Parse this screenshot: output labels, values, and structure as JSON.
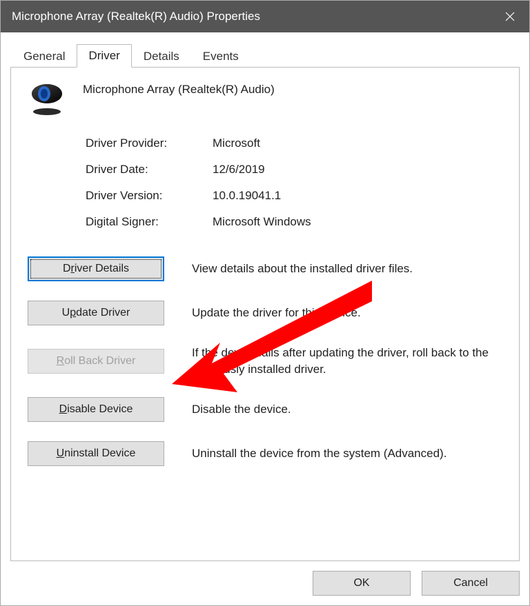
{
  "titlebar": {
    "title": "Microphone Array (Realtek(R) Audio) Properties"
  },
  "tabs": {
    "general": "General",
    "driver": "Driver",
    "details": "Details",
    "events": "Events"
  },
  "device": {
    "name": "Microphone Array (Realtek(R) Audio)"
  },
  "info": {
    "provider_label": "Driver Provider:",
    "provider_value": "Microsoft",
    "date_label": "Driver Date:",
    "date_value": "12/6/2019",
    "version_label": "Driver Version:",
    "version_value": "10.0.19041.1",
    "signer_label": "Digital Signer:",
    "signer_value": "Microsoft Windows"
  },
  "actions": {
    "details_label_pre": "D",
    "details_label_mid": "r",
    "details_label_post": "iver Details",
    "details_desc": "View details about the installed driver files.",
    "update_label_pre": "U",
    "update_label_mid": "p",
    "update_label_post": "date Driver",
    "update_desc": "Update the driver for this device.",
    "rollback_label_pre": "",
    "rollback_label_mid": "R",
    "rollback_label_post": "oll Back Driver",
    "rollback_desc": "If the device fails after updating the driver, roll back to the previously installed driver.",
    "disable_label_pre": "",
    "disable_label_mid": "D",
    "disable_label_post": "isable Device",
    "disable_desc": "Disable the device.",
    "uninstall_label_pre": "",
    "uninstall_label_mid": "U",
    "uninstall_label_post": "ninstall Device",
    "uninstall_desc": "Uninstall the device from the system (Advanced)."
  },
  "dialog": {
    "ok": "OK",
    "cancel": "Cancel"
  }
}
